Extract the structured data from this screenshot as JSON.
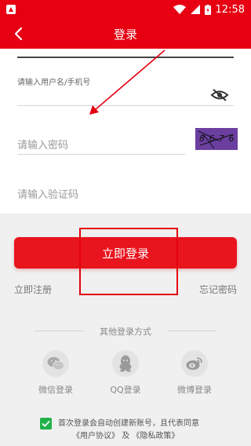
{
  "status_bar": {
    "time": "12:58"
  },
  "header": {
    "title": "登录"
  },
  "form": {
    "username_label": "请输入用户名/手机号",
    "password_placeholder": "请输入密码",
    "captcha_placeholder": "请输入验证码",
    "captcha_text": "8 6 7 6"
  },
  "actions": {
    "login_label": "立即登录",
    "register_label": "立即注册",
    "forgot_label": "忘记密码"
  },
  "other_login": {
    "title": "其他登录方式",
    "options": [
      {
        "label": "微信登录",
        "icon": "wechat-icon"
      },
      {
        "label": "QQ登录",
        "icon": "qq-icon"
      },
      {
        "label": "微博登录",
        "icon": "weibo-icon"
      }
    ]
  },
  "agreement": {
    "checked": true,
    "line1": "首次登录会自动创建新账号，且代表同意",
    "user_agreement": "《用户协议》",
    "and": "及",
    "privacy_policy": "《隐私政策》"
  },
  "colors": {
    "brand": "#e60012",
    "checkbox": "#21b14a",
    "annotation": "#e4000f"
  }
}
